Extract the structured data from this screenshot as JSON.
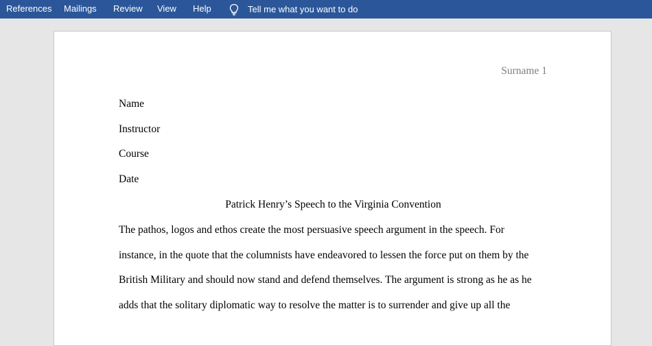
{
  "ribbon": {
    "tabs": [
      "References",
      "Mailings",
      "Review",
      "View",
      "Help"
    ],
    "tell_me": "Tell me what you want to do",
    "tell_me_icon": "lightbulb-icon",
    "background_color": "#2b579a"
  },
  "document": {
    "header": "Surname 1",
    "info": {
      "name": "Name",
      "instructor": "Instructor",
      "course": "Course",
      "date": "Date"
    },
    "title": "Patrick Henry’s Speech to the Virginia Convention",
    "body_lines": [
      "The pathos, logos and ethos create the most persuasive speech argument in the speech. For",
      "instance, in the quote that the columnists have endeavored to lessen the force put on them by the",
      "British Military and should now stand and defend themselves. The argument is strong as he as he",
      "adds that the solitary diplomatic way to resolve the matter is to surrender and give up all the"
    ]
  }
}
